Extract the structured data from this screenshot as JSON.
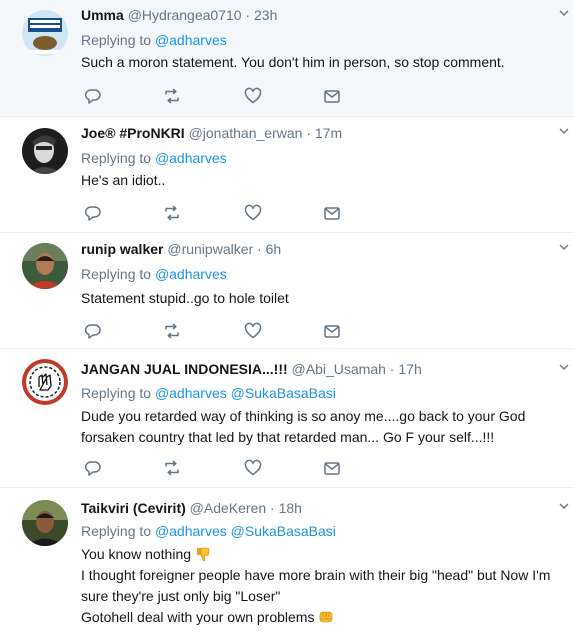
{
  "reply_prefix": "Replying to",
  "tweets": [
    {
      "name": "Umma",
      "handle": "@Hydrangea0710",
      "time": "23h",
      "replying_to": [
        "@adharves"
      ],
      "text": [
        "Such a moron statement. You don't him in person, so stop comment."
      ]
    },
    {
      "name": "Joe® #ProNKRI",
      "handle": "@jonathan_erwan",
      "time": "17m",
      "replying_to": [
        "@adharves"
      ],
      "text": [
        "He's an idiot.."
      ]
    },
    {
      "name": "runip walker",
      "handle": "@runipwalker",
      "time": "6h",
      "replying_to": [
        "@adharves"
      ],
      "text": [
        "Statement stupid..go to hole toilet"
      ]
    },
    {
      "name": "JANGAN JUAL INDONESIA...!!!",
      "handle": "@Abi_Usamah",
      "time": "17h",
      "replying_to": [
        "@adharves",
        "@SukaBasaBasi"
      ],
      "text": [
        "Dude you retarded way of thinking is so anoy me....go back to your God",
        "forsaken country that led by that retarded man... Go F your self...!!!"
      ]
    },
    {
      "name": "Taikviri (Cevirit)",
      "handle": "@AdeKeren",
      "time": "18h",
      "replying_to": [
        "@adharves",
        "@SukaBasaBasi"
      ],
      "text": [
        "You know nothing",
        "I thought foreigner people have more brain with their big \"head\" but Now I'm",
        "sure they're just only big \"Loser\"",
        "Gotohell deal with your own problems"
      ],
      "emojis": [
        "thumbs-down",
        "fist"
      ]
    }
  ],
  "colors": {
    "mention": "#1b95e0",
    "meta": "#657786",
    "icon": "#657786",
    "highlight_bg": "#f5f8fa"
  }
}
